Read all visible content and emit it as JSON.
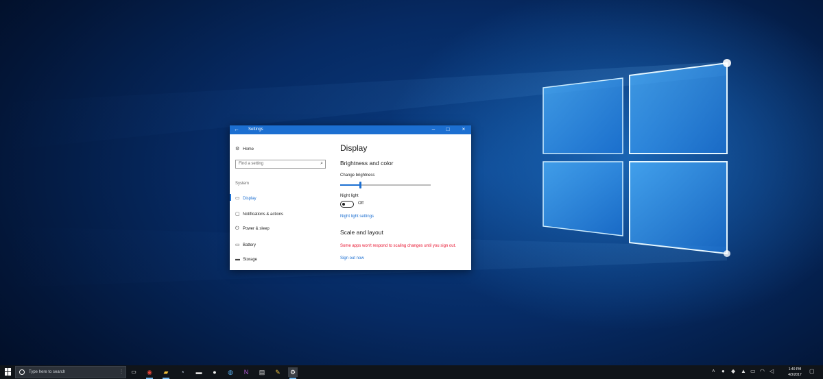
{
  "window": {
    "title": "Settings",
    "back_icon": "back-arrow-icon",
    "controls": [
      "minimize-icon",
      "maximize-icon",
      "close-icon"
    ]
  },
  "nav": {
    "home_label": "Home",
    "search_placeholder": "Find a setting",
    "section_label": "System",
    "items": [
      {
        "label": "Display",
        "icon": "monitor-icon",
        "active": true
      },
      {
        "label": "Notifications & actions",
        "icon": "notification-icon",
        "active": false
      },
      {
        "label": "Power & sleep",
        "icon": "power-icon",
        "active": false
      },
      {
        "label": "Battery",
        "icon": "battery-icon",
        "active": false
      },
      {
        "label": "Storage",
        "icon": "storage-icon",
        "active": false
      }
    ]
  },
  "content": {
    "page_title": "Display",
    "brightness_heading": "Brightness and color",
    "brightness_label": "Change brightness",
    "brightness_level": 0.22,
    "night_light_label": "Night light",
    "night_light_state": "Off",
    "night_light_link": "Night light settings",
    "scale_heading": "Scale and layout",
    "scale_warning": "Some apps won't respond to scaling changes until you sign out.",
    "sign_out_link": "Sign out now"
  },
  "taskbar": {
    "search_placeholder": "Type here to search",
    "apps": [
      "task-view-icon",
      "chrome-icon",
      "file-explorer-icon",
      "steam-icon",
      "app-icon",
      "app-icon",
      "app-icon",
      "onenote-icon",
      "document-icon",
      "app-icon",
      "settings-icon"
    ],
    "clock_time": "1:40 PM",
    "clock_date": "4/3/2017"
  },
  "colors": {
    "accent": "#1c6fd1",
    "warning": "#e8112d",
    "taskbar": "#101419"
  }
}
